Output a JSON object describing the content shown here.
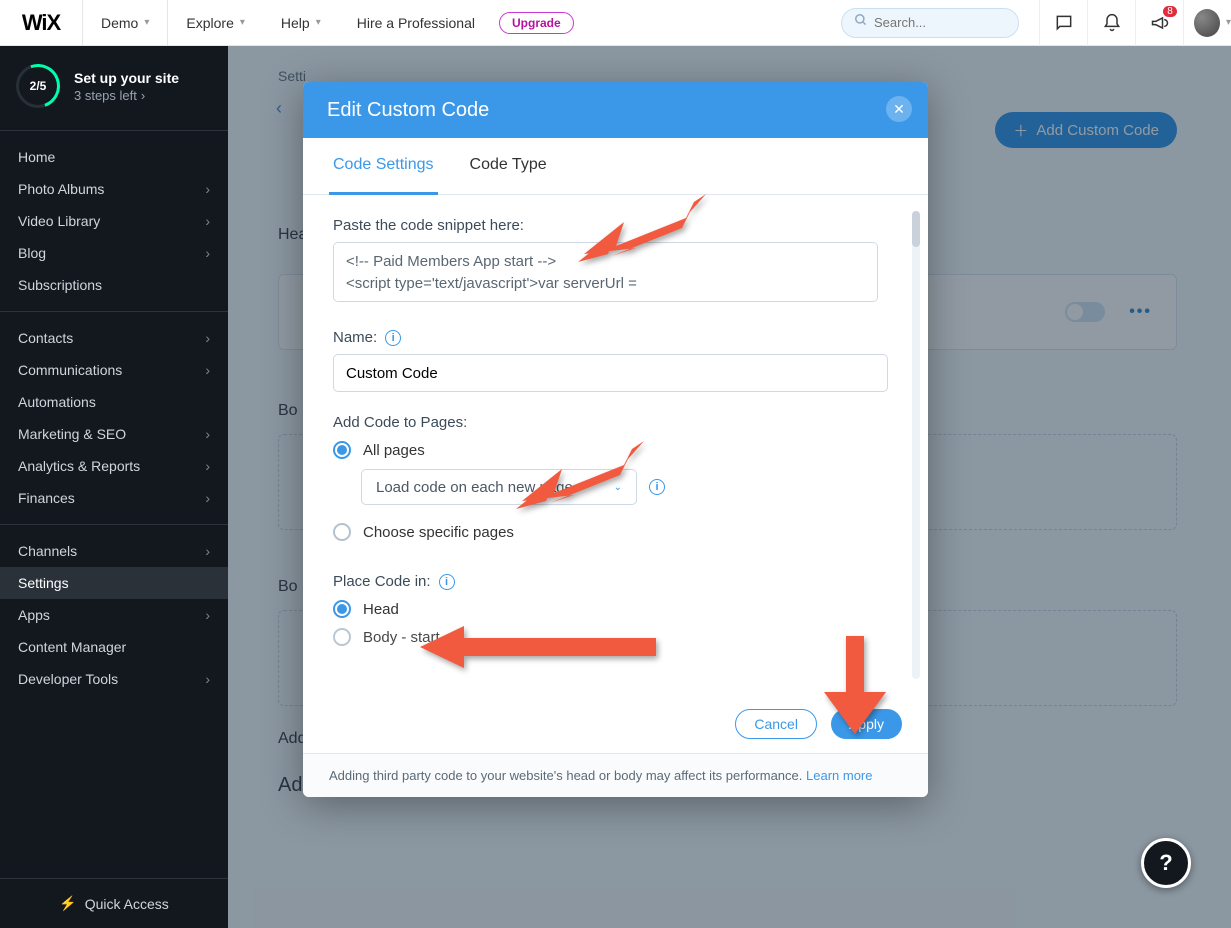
{
  "topbar": {
    "logo": "WiX",
    "site_selector": "Demo",
    "menu": {
      "explore": "Explore",
      "help": "Help",
      "hire": "Hire a Professional",
      "upgrade": "Upgrade"
    },
    "search_placeholder": "Search...",
    "notif_badge": "8"
  },
  "setup": {
    "progress": "2/5",
    "title": "Set up your site",
    "subtitle": "3 steps left"
  },
  "sidebar": {
    "group1": [
      "Home",
      "Photo Albums",
      "Video Library",
      "Blog",
      "Subscriptions"
    ],
    "group2": [
      "Contacts",
      "Communications",
      "Automations",
      "Marketing & SEO",
      "Analytics & Reports",
      "Finances"
    ],
    "group3": [
      "Channels",
      "Settings",
      "Apps",
      "Content Manager",
      "Developer Tools"
    ],
    "quick": "Quick Access"
  },
  "page": {
    "breadcrumb_prefix": "Setti",
    "add_custom_code": "Add Custom Code",
    "sec_head": "Hea",
    "sec_body": "Bo",
    "sec_body2": "Bo",
    "add_line": "Add",
    "add_line2": "Ad"
  },
  "modal": {
    "title": "Edit Custom Code",
    "tabs": {
      "settings": "Code Settings",
      "type": "Code Type"
    },
    "paste_label": "Paste the code snippet here:",
    "code_value": "<!-- Paid Members App start -->\n<script type='text/javascript'>var serverUrl =",
    "name_label": "Name:",
    "name_value": "Custom Code",
    "add_pages_label": "Add Code to Pages:",
    "radio_all": "All pages",
    "select_value": "Load code on each new page",
    "radio_specific": "Choose specific pages",
    "place_label": "Place Code in:",
    "radio_head": "Head",
    "radio_body_start": "Body - start",
    "cancel": "Cancel",
    "apply": "Apply",
    "footer_note": "Adding third party code to your website's head or body may affect its performance.",
    "footer_link": "Learn more"
  }
}
